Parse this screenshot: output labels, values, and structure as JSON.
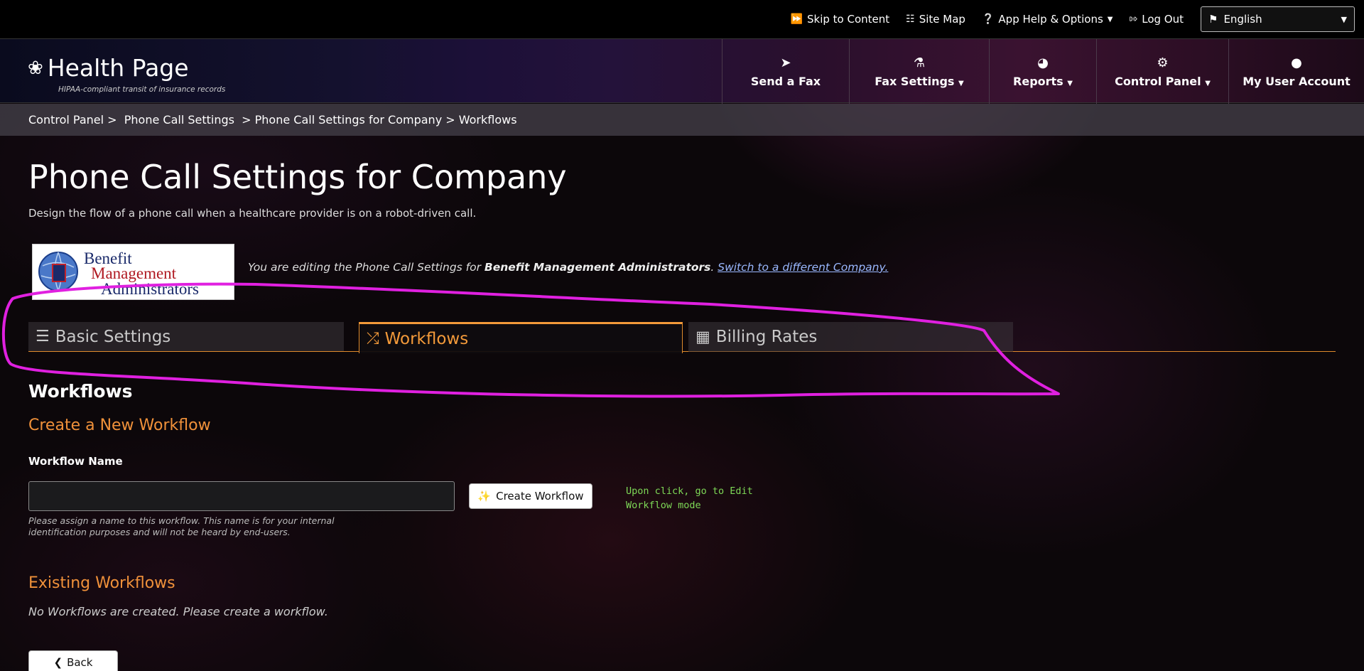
{
  "topbar": {
    "skip": {
      "icon": "fast-forward-icon",
      "label": "Skip to Content"
    },
    "sitemap": {
      "icon": "sitemap-icon",
      "label": "Site Map"
    },
    "help": {
      "icon": "question-circle-icon",
      "label": "App Help & Options"
    },
    "logout": {
      "icon": "sign-out-icon",
      "label": "Log Out"
    },
    "language": {
      "icon": "flag-icon",
      "value": "English"
    }
  },
  "brand": {
    "name": "Health Page",
    "tagline": "HIPAA-compliant transit of insurance records"
  },
  "nav": {
    "send_fax": {
      "icon": "paper-plane-icon",
      "label": "Send a Fax"
    },
    "fax_settings": {
      "icon": "flask-icon",
      "label": "Fax Settings"
    },
    "reports": {
      "icon": "pie-chart-icon",
      "label": "Reports"
    },
    "control_panel": {
      "icon": "gear-icon",
      "label": "Control Panel"
    },
    "my_account": {
      "icon": "user-icon",
      "label": "My User Account"
    }
  },
  "breadcrumb": "Control Panel >  Phone Call Settings  > Phone Call Settings for Company > Workflows",
  "page": {
    "title": "Phone Call Settings for Company",
    "subtitle": "Design the flow of a phone call when a healthcare provider is on a robot-driven call."
  },
  "company": {
    "logo_line1": "Benefit",
    "logo_line2": "Management",
    "logo_line3": "Administrators",
    "editing_prefix": "You are editing the Phone Call Settings for ",
    "name": "Benefit Management Administrators",
    "switch_link": "Switch to a different Company."
  },
  "tabs": [
    {
      "icon": "sliders-icon",
      "label": "Basic Settings",
      "active": false
    },
    {
      "icon": "shuffle-icon",
      "label": "Workflows",
      "active": true
    },
    {
      "icon": "money-bill-icon",
      "label": "Billing Rates",
      "active": false
    }
  ],
  "workflows": {
    "heading": "Workflows",
    "create_heading": "Create a New Workflow",
    "name_label": "Workflow Name",
    "name_value": "",
    "help_text": "Please assign a name to this workflow. This name is for your internal identification purposes and will not be heard by end-users.",
    "create_button": "Create Workflow",
    "annotation": "Upon click, go to Edit Workflow mode",
    "existing_heading": "Existing Workflows",
    "empty_message": "No Workflows are created. Please create a workflow.",
    "back_button": "Back"
  },
  "colors": {
    "accent": "#f0913a",
    "annotation": "#7ed957",
    "scribble": "#e020e0",
    "link": "#9ab8ff"
  }
}
